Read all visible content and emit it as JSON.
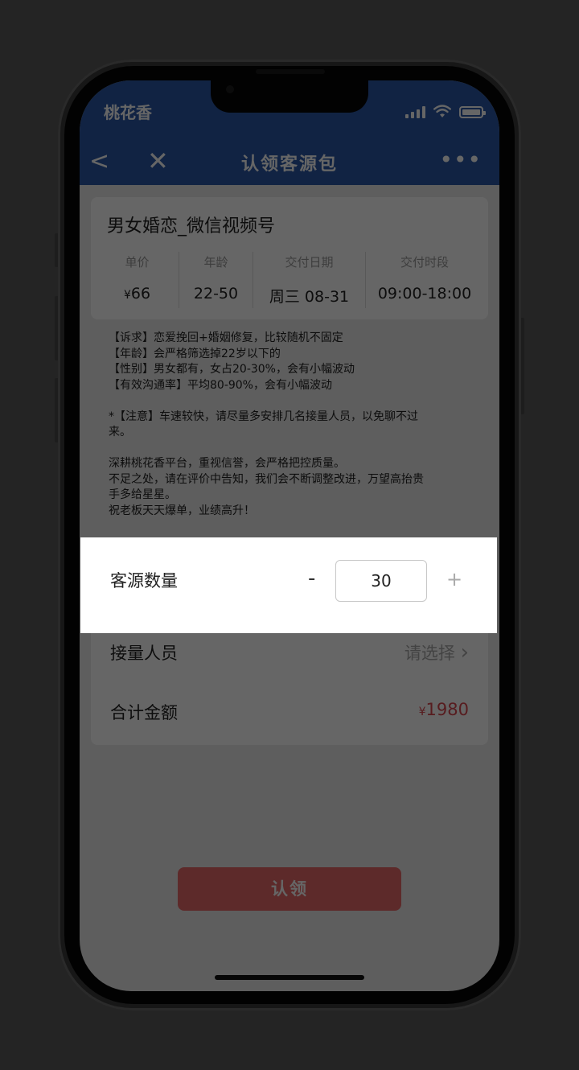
{
  "status_bar": {
    "carrier": "桃花香"
  },
  "nav": {
    "back": "<",
    "close": "✕",
    "title": "认领客源包",
    "more": "•••"
  },
  "package": {
    "title": "男女婚恋_微信视频号",
    "info": [
      {
        "label": "单价",
        "value_prefix": "¥",
        "value": "66"
      },
      {
        "label": "年龄",
        "value_prefix": "",
        "value": "22-50"
      },
      {
        "label": "交付日期",
        "value_prefix": "",
        "value": "周三 08-31"
      },
      {
        "label": "交付时段",
        "value_prefix": "",
        "value": "09:00-18:00"
      }
    ],
    "description": [
      "【诉求】恋爱挽回+婚姻修复，比较随机不固定",
      "【年龄】会严格筛选掉22岁以下的",
      "【性别】男女都有，女占20-30%，会有小幅波动",
      "【有效沟通率】平均80-90%，会有小幅波动",
      "",
      "*【注意】车速较快，请尽量多安排几名接量人员，以免聊不过",
      "来。",
      "",
      "深耕桃花香平台，重视信誉，会严格把控质量。",
      "不足之处，请在评价中告知，我们会不断调整改进，万望高抬贵",
      "手多给星星。",
      "祝老板天天爆单，业绩高升！"
    ]
  },
  "form": {
    "quantity_label": "客源数量",
    "minus_label": "-",
    "quantity_value": "30",
    "plus_label": "+",
    "staff_label": "接量人员",
    "staff_placeholder": "请选择",
    "staff_chevron": "›",
    "total_label": "合计金额",
    "total_currency": "¥",
    "total_value": "1980"
  },
  "claim_button": "认领",
  "colors": {
    "header": "#2b59a8",
    "price": "#d9474f",
    "button": "#e86a6a"
  }
}
